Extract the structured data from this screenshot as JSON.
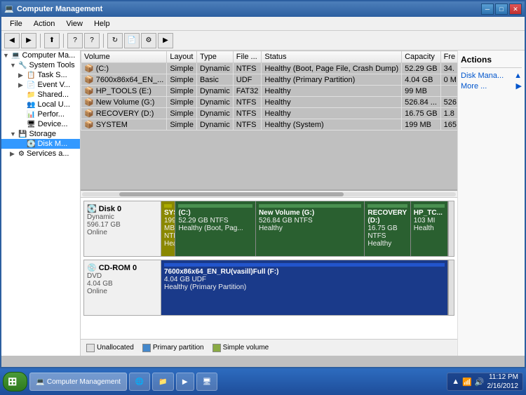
{
  "titlebar": {
    "title": "Computer Management",
    "min_btn": "─",
    "max_btn": "□",
    "close_btn": "✕"
  },
  "menubar": {
    "items": [
      "File",
      "Action",
      "View",
      "Help"
    ]
  },
  "tree": {
    "items": [
      {
        "id": "computer-mgmt",
        "label": "Computer Ma...",
        "level": 0,
        "expanded": true,
        "icon": "💻"
      },
      {
        "id": "system-tools",
        "label": "System Tools",
        "level": 1,
        "expanded": true,
        "icon": "🔧"
      },
      {
        "id": "task-scheduler",
        "label": "Task S...",
        "level": 2,
        "icon": "📋"
      },
      {
        "id": "event-viewer",
        "label": "Event V...",
        "level": 2,
        "icon": "📄"
      },
      {
        "id": "shared-folders",
        "label": "Shared...",
        "level": 2,
        "icon": "📁"
      },
      {
        "id": "local-users",
        "label": "Local U...",
        "level": 2,
        "icon": "👥"
      },
      {
        "id": "performance",
        "label": "Perfor...",
        "level": 2,
        "icon": "📊"
      },
      {
        "id": "device-manager",
        "label": "Device...",
        "level": 2,
        "icon": "🖥"
      },
      {
        "id": "storage",
        "label": "Storage",
        "level": 1,
        "expanded": true,
        "icon": "💾"
      },
      {
        "id": "disk-mgmt",
        "label": "Disk M...",
        "level": 2,
        "icon": "💽",
        "selected": true
      },
      {
        "id": "services",
        "label": "Services a...",
        "level": 1,
        "icon": "⚙"
      }
    ]
  },
  "table": {
    "columns": [
      "Volume",
      "Layout",
      "Type",
      "File ...",
      "Status",
      "Capacity",
      "Fre"
    ],
    "rows": [
      {
        "icon": "📦",
        "volume": "(C:)",
        "layout": "Simple",
        "type": "Dynamic",
        "filesystem": "NTFS",
        "status": "Healthy (Boot, Page File, Crash Dump)",
        "capacity": "52.29 GB",
        "free": "34."
      },
      {
        "icon": "💿",
        "volume": "7600x86x64_EN_...",
        "layout": "Simple",
        "type": "Basic",
        "filesystem": "UDF",
        "status": "Healthy (Primary Partition)",
        "capacity": "4.04 GB",
        "free": "0 M"
      },
      {
        "icon": "📦",
        "volume": "HP_TOOLS (E:)",
        "layout": "Simple",
        "type": "Dynamic",
        "filesystem": "FAT32",
        "status": "Healthy",
        "capacity": "99 MB",
        "free": ""
      },
      {
        "icon": "📦",
        "volume": "New Volume (G:)",
        "layout": "Simple",
        "type": "Dynamic",
        "filesystem": "NTFS",
        "status": "Healthy",
        "capacity": "526.84 ...",
        "free": "526"
      },
      {
        "icon": "📦",
        "volume": "RECOVERY (D:)",
        "layout": "Simple",
        "type": "Dynamic",
        "filesystem": "NTFS",
        "status": "Healthy",
        "capacity": "16.75 GB",
        "free": "1.8"
      },
      {
        "icon": "📦",
        "volume": "SYSTEM",
        "layout": "Simple",
        "type": "Dynamic",
        "filesystem": "NTFS",
        "status": "Healthy (System)",
        "capacity": "199 MB",
        "free": "165"
      }
    ]
  },
  "disks": [
    {
      "id": "disk0",
      "name": "Disk 0",
      "type": "Dynamic",
      "size": "596.17 GB",
      "status": "Online",
      "partitions": [
        {
          "name": "SYSTE...",
          "size": "199 MB",
          "fs": "NTFS",
          "detail": "Healthy",
          "color": "olive",
          "width": "4%"
        },
        {
          "name": "(C:)",
          "size": "52.29 GB NTFS",
          "fs": "",
          "detail": "Healthy (Boot, Pag...",
          "color": "darkgreen",
          "width": "30%"
        },
        {
          "name": "New Volume  (G:)",
          "size": "526.84 GB NTFS",
          "fs": "",
          "detail": "Healthy",
          "color": "darkgreen",
          "width": "40%"
        },
        {
          "name": "RECOVERY  (D:)",
          "size": "16.75 GB NTFS",
          "fs": "",
          "detail": "Healthy",
          "color": "darkgreen",
          "width": "14%"
        },
        {
          "name": "HP_TC...",
          "size": "103 MI",
          "fs": "",
          "detail": "Health",
          "color": "darkgreen",
          "width": "8%"
        }
      ]
    },
    {
      "id": "cdrom0",
      "name": "CD-ROM 0",
      "type": "DVD",
      "size": "4.04 GB",
      "status": "Online",
      "partitions": [
        {
          "name": "7600x86x64_EN_RU(vasill)Full  (F:)",
          "size": "4.04 GB UDF",
          "fs": "",
          "detail": "Healthy (Primary Partition)",
          "color": "blue",
          "width": "100%"
        }
      ]
    }
  ],
  "legend": {
    "items": [
      {
        "label": "Unallocated",
        "color": "unalloc"
      },
      {
        "label": "Primary partition",
        "color": "primary"
      },
      {
        "label": "Simple volume",
        "color": "simple"
      }
    ]
  },
  "actions": {
    "title": "Actions",
    "items": [
      {
        "label": "Disk Mana...",
        "arrow": "▲"
      },
      {
        "label": "More ...",
        "arrow": "▶"
      }
    ]
  },
  "taskbar": {
    "start_label": "Start",
    "items": [
      {
        "label": "Computer Management",
        "active": true
      },
      {
        "label": "IE",
        "active": false
      },
      {
        "label": "Folder",
        "active": false
      },
      {
        "label": "Media",
        "active": false
      },
      {
        "label": "Network",
        "active": false
      }
    ],
    "clock": {
      "time": "11:12 PM",
      "date": "2/16/2012"
    }
  }
}
